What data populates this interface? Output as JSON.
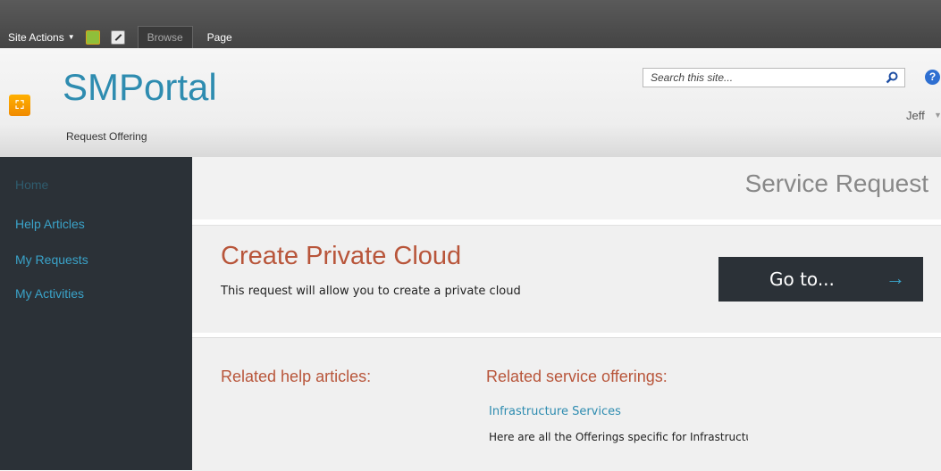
{
  "ribbon": {
    "site_actions_label": "Site Actions",
    "tabs": [
      {
        "label": "Browse",
        "selected": true
      },
      {
        "label": "Page",
        "selected": false
      }
    ]
  },
  "header": {
    "site_title": "SMPortal",
    "breadcrumb": "Request Offering",
    "search_placeholder": "Search this site...",
    "user_name": "Jeff"
  },
  "leftnav": {
    "items": [
      {
        "label": "Home"
      },
      {
        "label": "Help Articles"
      },
      {
        "label": "My Requests"
      },
      {
        "label": "My Activities"
      }
    ]
  },
  "main": {
    "page_title": "Service Request",
    "offering_title": "Create Private Cloud",
    "offering_description": "This request will allow you to create a private cloud",
    "goto_label": "Go to...",
    "related_help_heading": "Related help articles:",
    "related_services_heading": "Related service offerings:",
    "related_services": [
      {
        "title": "Infrastructure Services",
        "description": "Here are all the Offerings specific for Infrastructure"
      }
    ]
  },
  "colors": {
    "accent_blue": "#2e8cb0",
    "accent_orange": "#b8553a",
    "nav_bg": "#2b3137"
  }
}
